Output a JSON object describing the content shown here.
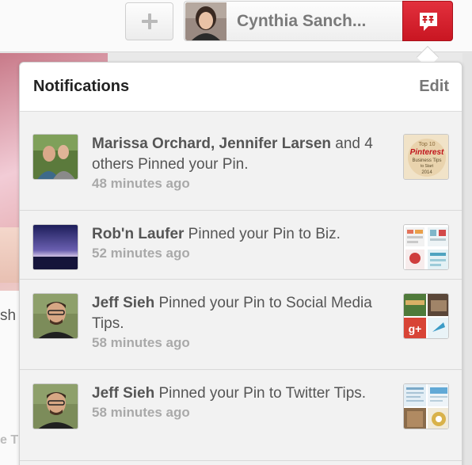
{
  "header": {
    "add_icon": "plus-icon",
    "profile_name": "Cynthia Sanch...",
    "notifications_icon": "speech-bubble-pins-icon",
    "colors": {
      "accent": "#cb2027",
      "muted": "#a9a9a9"
    }
  },
  "background": {
    "left_text": "sh",
    "left_text_bottom": "e Ti"
  },
  "notifications": {
    "title": "Notifications",
    "edit_label": "Edit",
    "items": [
      {
        "actors": "Marissa Orchard, Jennifer Larsen",
        "message": " and 4 others Pinned your Pin.",
        "time": "48 minutes ago",
        "thumb_text_1": "Top 10",
        "thumb_text_2": "Pinterest",
        "thumb_text_3": "Business Tips",
        "thumb_text_4": "to Start",
        "thumb_text_5": "2014"
      },
      {
        "actors": "Rob'n Laufer",
        "message": " Pinned your Pin to Biz.",
        "time": "52 minutes ago"
      },
      {
        "actors": "Jeff Sieh",
        "message": " Pinned your Pin to Social Media Tips.",
        "time": "58 minutes ago"
      },
      {
        "actors": "Jeff Sieh",
        "message": " Pinned your Pin to Twitter Tips.",
        "time": "58 minutes ago"
      }
    ]
  }
}
